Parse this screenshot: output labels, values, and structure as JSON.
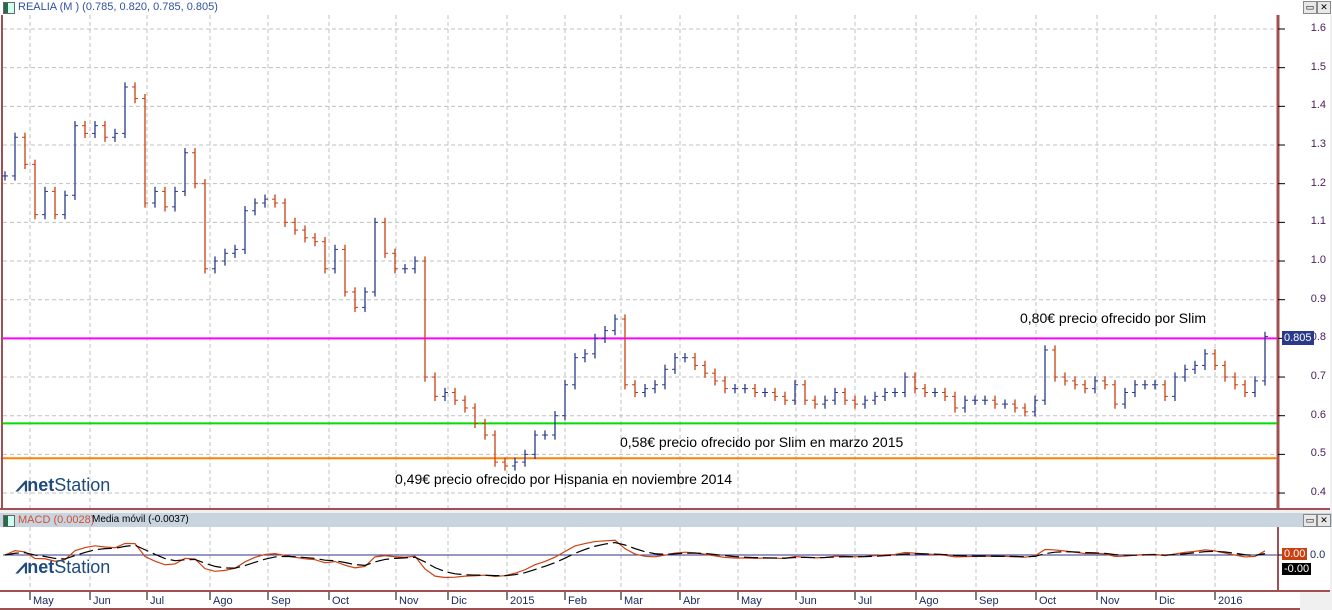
{
  "main_panel": {
    "title": "REALIA (M ) (0.785, 0.820, 0.785, 0.805)",
    "last_price_label": "0.805",
    "logo_text": {
      "bold": "net",
      "rest": "Station"
    }
  },
  "macd_panel": {
    "title_macd": "MACD (0.0028)",
    "title_signal": "Media móvil (-0.0037)",
    "macd_value": "0.00",
    "signal_value": "-0.00",
    "zero_label": "0.0",
    "logo_text": {
      "bold": "net",
      "rest": "Station"
    }
  },
  "window_buttons": {
    "maximize": "▭",
    "close": "✕"
  },
  "annotations": [
    {
      "text": "0,80€ precio ofrecido por Slim",
      "price": 0.8,
      "color": "#ff00ff"
    },
    {
      "text": "0,58€ precio ofrecido por Slim en marzo 2015",
      "price": 0.58,
      "color": "#00dd00"
    },
    {
      "text": "0,49€ precio ofrecido por Hispania en noviembre 2014",
      "price": 0.49,
      "color": "#ff8000"
    }
  ],
  "chart_data": {
    "type": "ohlc",
    "y_ticks": [
      "1.6",
      "1.5",
      "1.4",
      "1.3",
      "1.2",
      "1.1",
      "1.0",
      "0.9",
      "0.8",
      "0.7",
      "0.6",
      "0.5",
      "0.4"
    ],
    "ylim": [
      0.4,
      1.6
    ],
    "x_labels": [
      "May",
      "Jun",
      "Jul",
      "Ago",
      "Sep",
      "Oct",
      "Nov",
      "Dic",
      "2015",
      "Feb",
      "Mar",
      "Abr",
      "May",
      "Jun",
      "Jul",
      "Ago",
      "Sep",
      "Oct",
      "Nov",
      "Dic",
      "2016"
    ],
    "closes": [
      1.22,
      1.32,
      1.25,
      1.12,
      1.18,
      1.12,
      1.17,
      1.35,
      1.33,
      1.35,
      1.32,
      1.33,
      1.45,
      1.42,
      1.15,
      1.18,
      1.14,
      1.18,
      1.28,
      1.2,
      0.98,
      1.0,
      1.02,
      1.03,
      1.13,
      1.15,
      1.16,
      1.15,
      1.1,
      1.08,
      1.06,
      1.05,
      0.98,
      1.03,
      0.92,
      0.88,
      0.92,
      1.1,
      1.02,
      0.98,
      0.98,
      1.0,
      0.7,
      0.65,
      0.66,
      0.64,
      0.62,
      0.58,
      0.55,
      0.48,
      0.47,
      0.48,
      0.5,
      0.55,
      0.55,
      0.6,
      0.68,
      0.75,
      0.76,
      0.8,
      0.82,
      0.85,
      0.68,
      0.66,
      0.67,
      0.68,
      0.72,
      0.75,
      0.75,
      0.73,
      0.71,
      0.69,
      0.67,
      0.67,
      0.67,
      0.66,
      0.66,
      0.65,
      0.64,
      0.68,
      0.64,
      0.63,
      0.64,
      0.66,
      0.64,
      0.63,
      0.64,
      0.65,
      0.66,
      0.66,
      0.7,
      0.67,
      0.66,
      0.66,
      0.65,
      0.62,
      0.64,
      0.64,
      0.64,
      0.63,
      0.63,
      0.62,
      0.61,
      0.64,
      0.77,
      0.7,
      0.69,
      0.68,
      0.67,
      0.69,
      0.68,
      0.63,
      0.66,
      0.68,
      0.68,
      0.68,
      0.65,
      0.7,
      0.72,
      0.73,
      0.76,
      0.73,
      0.7,
      0.68,
      0.66,
      0.69,
      0.805
    ],
    "up_color": "#2a3a8a",
    "down_color": "#c84010"
  }
}
